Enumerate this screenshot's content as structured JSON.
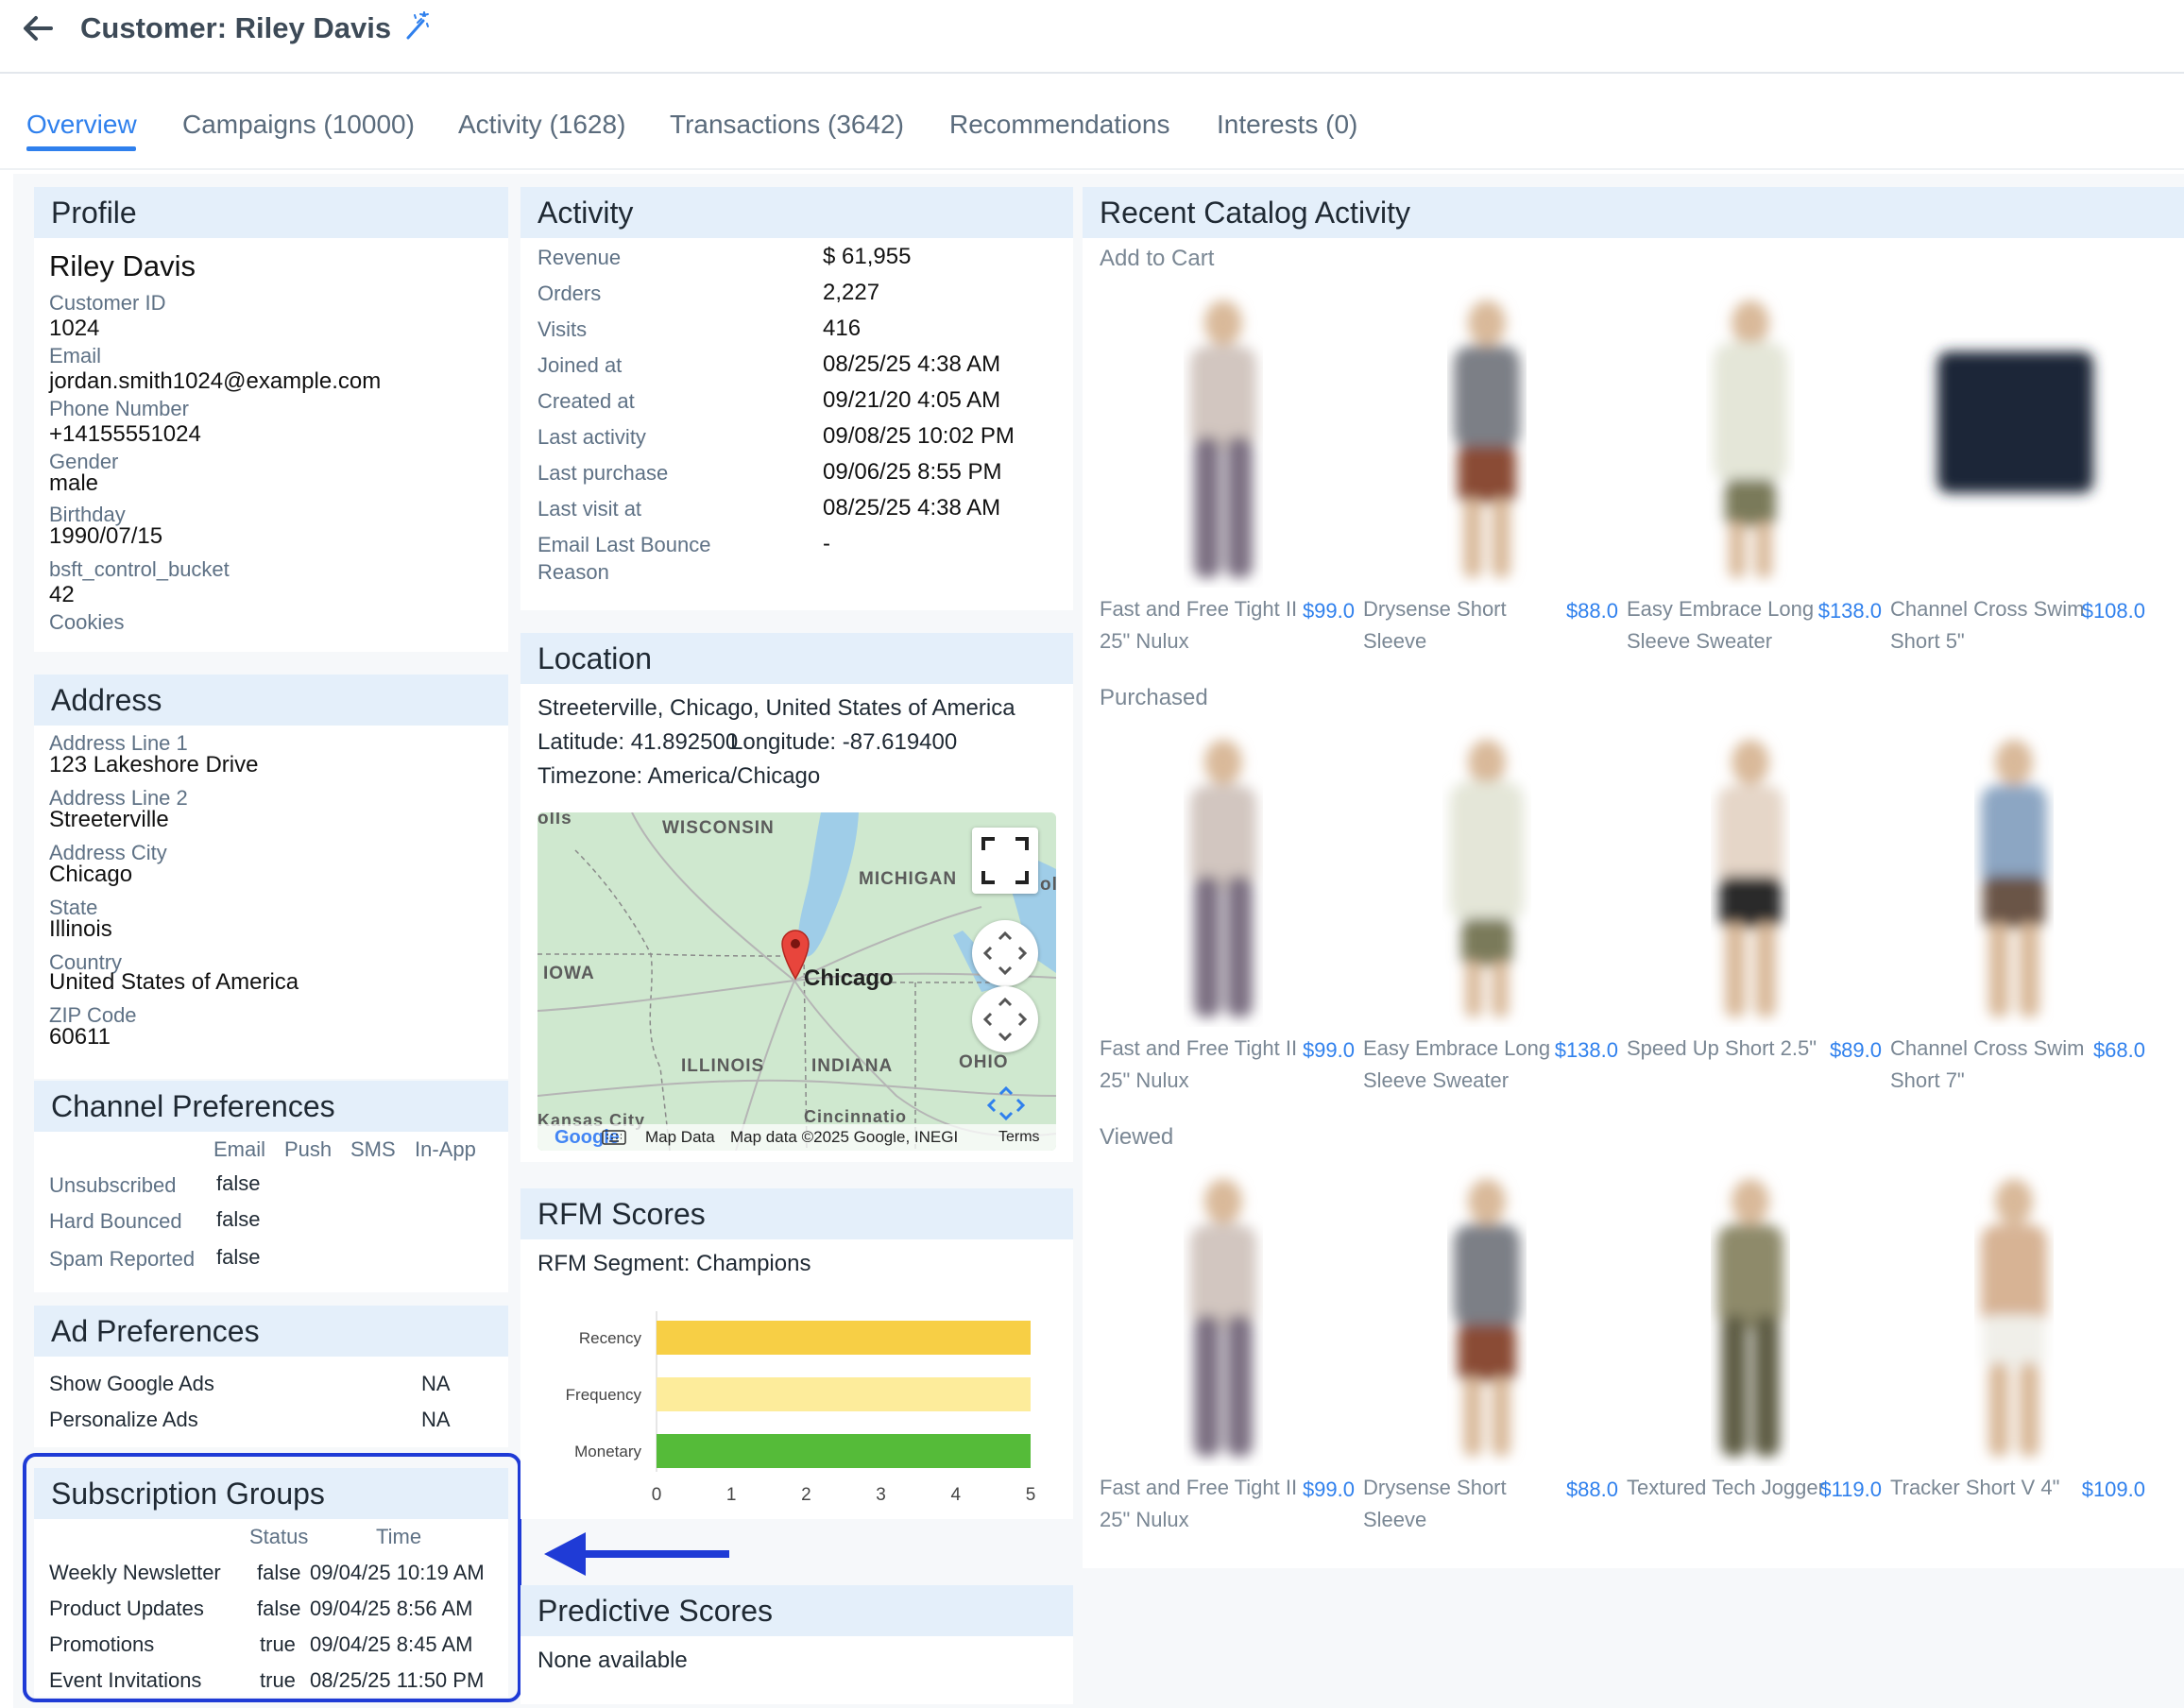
{
  "header": {
    "title": "Customer: Riley Davis"
  },
  "tabs": [
    {
      "label": "Overview"
    },
    {
      "label": "Campaigns (10000)"
    },
    {
      "label": "Activity (1628)"
    },
    {
      "label": "Transactions (3642)"
    },
    {
      "label": "Recommendations"
    },
    {
      "label": "Interests (0)"
    }
  ],
  "profile": {
    "title": "Profile",
    "name": "Riley Davis",
    "fields": [
      {
        "label": "Customer ID",
        "value": "1024"
      },
      {
        "label": "Email",
        "value": "jordan.smith1024@example.com"
      },
      {
        "label": "Phone Number",
        "value": "+14155551024"
      },
      {
        "label": "Gender",
        "value": "male"
      },
      {
        "label": "Birthday",
        "value": "1990/07/15"
      },
      {
        "label": "bsft_control_bucket",
        "value": "42"
      },
      {
        "label": "Cookies",
        "value": ""
      }
    ]
  },
  "address": {
    "title": "Address",
    "fields": [
      {
        "label": "Address Line 1",
        "value": "123 Lakeshore Drive"
      },
      {
        "label": "Address Line 2",
        "value": "Streeterville"
      },
      {
        "label": "Address City",
        "value": "Chicago"
      },
      {
        "label": "State",
        "value": "Illinois"
      },
      {
        "label": "Country",
        "value": "United States of America"
      },
      {
        "label": "ZIP Code",
        "value": "60611"
      }
    ]
  },
  "channel": {
    "title": "Channel Preferences",
    "columns": [
      "Email",
      "Push",
      "SMS",
      "In-App"
    ],
    "rows": [
      {
        "label": "Unsubscribed",
        "email": "false"
      },
      {
        "label": "Hard Bounced",
        "email": "false"
      },
      {
        "label": "Spam Reported",
        "email": "false"
      }
    ]
  },
  "ads": {
    "title": "Ad Preferences",
    "rows": [
      {
        "label": "Show Google Ads",
        "value": "NA"
      },
      {
        "label": "Personalize Ads",
        "value": "NA"
      }
    ]
  },
  "subscriptions": {
    "title": "Subscription Groups",
    "col_status": "Status",
    "col_time": "Time",
    "rows": [
      {
        "name": "Weekly Newsletter",
        "status": "false",
        "time": "09/04/25 10:19 AM"
      },
      {
        "name": "Product Updates",
        "status": "false",
        "time": "09/04/25 8:56 AM"
      },
      {
        "name": "Promotions",
        "status": "true",
        "time": "09/04/25 8:45 AM"
      },
      {
        "name": "Event Invitations",
        "status": "true",
        "time": "08/25/25 11:50 PM"
      }
    ]
  },
  "activity": {
    "title": "Activity",
    "rows": [
      {
        "label": "Revenue",
        "value": "$ 61,955"
      },
      {
        "label": "Orders",
        "value": "2,227"
      },
      {
        "label": "Visits",
        "value": "416"
      },
      {
        "label": "Joined at",
        "value": "08/25/25 4:38 AM"
      },
      {
        "label": "Created at",
        "value": "09/21/20 4:05 AM"
      },
      {
        "label": "Last activity",
        "value": "09/08/25 10:02 PM"
      },
      {
        "label": "Last purchase",
        "value": "09/06/25 8:55 PM"
      },
      {
        "label": "Last visit at",
        "value": "08/25/25 4:38 AM"
      },
      {
        "label": "Email Last Bounce",
        "label2": "Reason",
        "value": "-"
      }
    ]
  },
  "location": {
    "title": "Location",
    "line1": "Streeterville, Chicago, United States of America",
    "lat_label": "Latitude: 41.892500",
    "lon_label": "Longitude: -87.619400",
    "timezone": "Timezone: America/Chicago",
    "map": {
      "labels": {
        "wisconsin": "WISCONSIN",
        "michigan": "MICHIGAN",
        "iowa": "IOWA",
        "illinois": "ILLINOIS",
        "indiana": "INDIANA",
        "ohio": "OHIO",
        "chicago": "Chicago",
        "cincinnati": "Cincinnatio",
        "kansas": "Kansas City",
        "top_left": "olls",
        "top_right": "ol"
      },
      "footer_mapdata": "Map Data",
      "footer_copyright": "Map data ©2025 Google, INEGI",
      "footer_terms": "Terms",
      "google": "Google"
    }
  },
  "rfm": {
    "title": "RFM Scores",
    "segment": "RFM Segment: Champions",
    "chart_data": {
      "type": "bar",
      "orientation": "horizontal",
      "categories": [
        "Recency",
        "Frequency",
        "Monetary"
      ],
      "values": [
        5,
        5,
        5
      ],
      "colors": [
        "#f7cf45",
        "#fdec9b",
        "#55bb39"
      ],
      "xlim": [
        0,
        5
      ],
      "ticks": [
        "0",
        "1",
        "2",
        "3",
        "4",
        "5"
      ]
    }
  },
  "predictive": {
    "title": "Predictive Scores",
    "text": "None available"
  },
  "catalog": {
    "title": "Recent Catalog Activity",
    "sections": [
      {
        "label": "Add to Cart",
        "items": [
          {
            "name": "Fast and Free Tight II 25\" Nulux",
            "price": "$99.0",
            "kind": "pants-purple"
          },
          {
            "name": "Drysense Short Sleeve",
            "price": "$88.0",
            "kind": "tee-gray"
          },
          {
            "name": "Easy Embrace Long Sleeve Sweater",
            "price": "$138.0",
            "kind": "sweater-cream"
          },
          {
            "name": "Channel Cross Swim Short 5\"",
            "price": "$108.0",
            "kind": "shorts-navy"
          }
        ]
      },
      {
        "label": "Purchased",
        "items": [
          {
            "name": "Fast and Free Tight II 25\" Nulux",
            "price": "$99.0",
            "kind": "pants-purple"
          },
          {
            "name": "Easy Embrace Long Sleeve Sweater",
            "price": "$138.0",
            "kind": "sweater-cream"
          },
          {
            "name": "Speed Up Short 2.5\"",
            "price": "$89.0",
            "kind": "shorts-black"
          },
          {
            "name": "Channel Cross Swim Short 7\"",
            "price": "$68.0",
            "kind": "shorts-blue"
          }
        ]
      },
      {
        "label": "Viewed",
        "items": [
          {
            "name": "Fast and Free Tight II 25\" Nulux",
            "price": "$99.0",
            "kind": "pants-purple"
          },
          {
            "name": "Drysense Short Sleeve",
            "price": "$88.0",
            "kind": "tee-gray"
          },
          {
            "name": "Textured Tech Jogger",
            "price": "$119.0",
            "kind": "jogger-olive"
          },
          {
            "name": "Tracker Short V 4\"",
            "price": "$109.0",
            "kind": "shorts-white"
          }
        ]
      }
    ]
  },
  "colors": {
    "accent": "#2f80ed",
    "card_header": "#e4effa",
    "highlight": "#1f3bd6"
  }
}
